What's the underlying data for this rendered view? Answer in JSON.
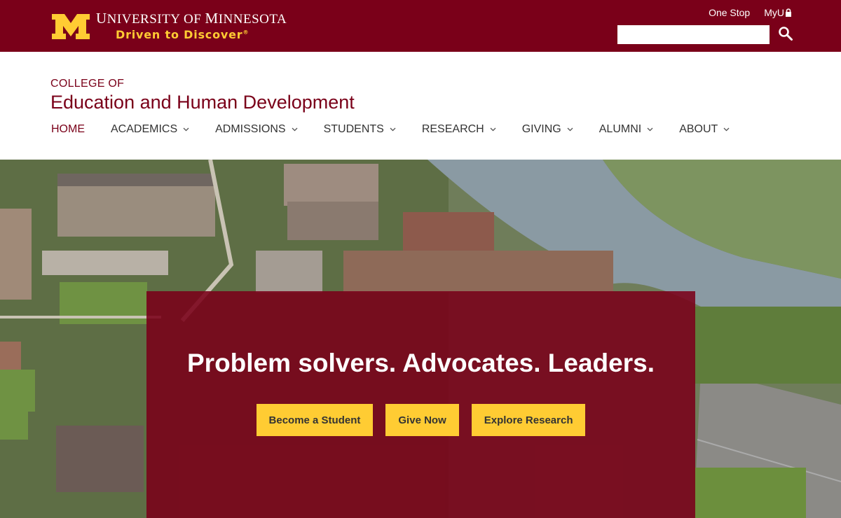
{
  "header": {
    "university_name_first": "U",
    "university_name_rest": "NIVERSITY OF ",
    "university_name_m": "M",
    "university_name_end": "INNESOTA",
    "tagline": "Driven to Discover",
    "tagline_mark": "®",
    "links": {
      "one_stop": "One Stop",
      "myu": "MyU"
    },
    "search": {
      "value": "",
      "placeholder": ""
    },
    "colors": {
      "maroon": "#7a0019",
      "gold": "#ffcc33"
    }
  },
  "college": {
    "prefix": "COLLEGE OF",
    "name": "Education and Human Development"
  },
  "nav": {
    "items": [
      {
        "label": "HOME"
      },
      {
        "label": "ACADEMICS"
      },
      {
        "label": "ADMISSIONS"
      },
      {
        "label": "STUDENTS"
      },
      {
        "label": "RESEARCH"
      },
      {
        "label": "GIVING"
      },
      {
        "label": "ALUMNI"
      },
      {
        "label": "ABOUT"
      }
    ]
  },
  "hero": {
    "headline": "Problem solvers. Advocates. Leaders.",
    "buttons": {
      "student": "Become a Student",
      "give": "Give Now",
      "research": "Explore Research"
    }
  }
}
